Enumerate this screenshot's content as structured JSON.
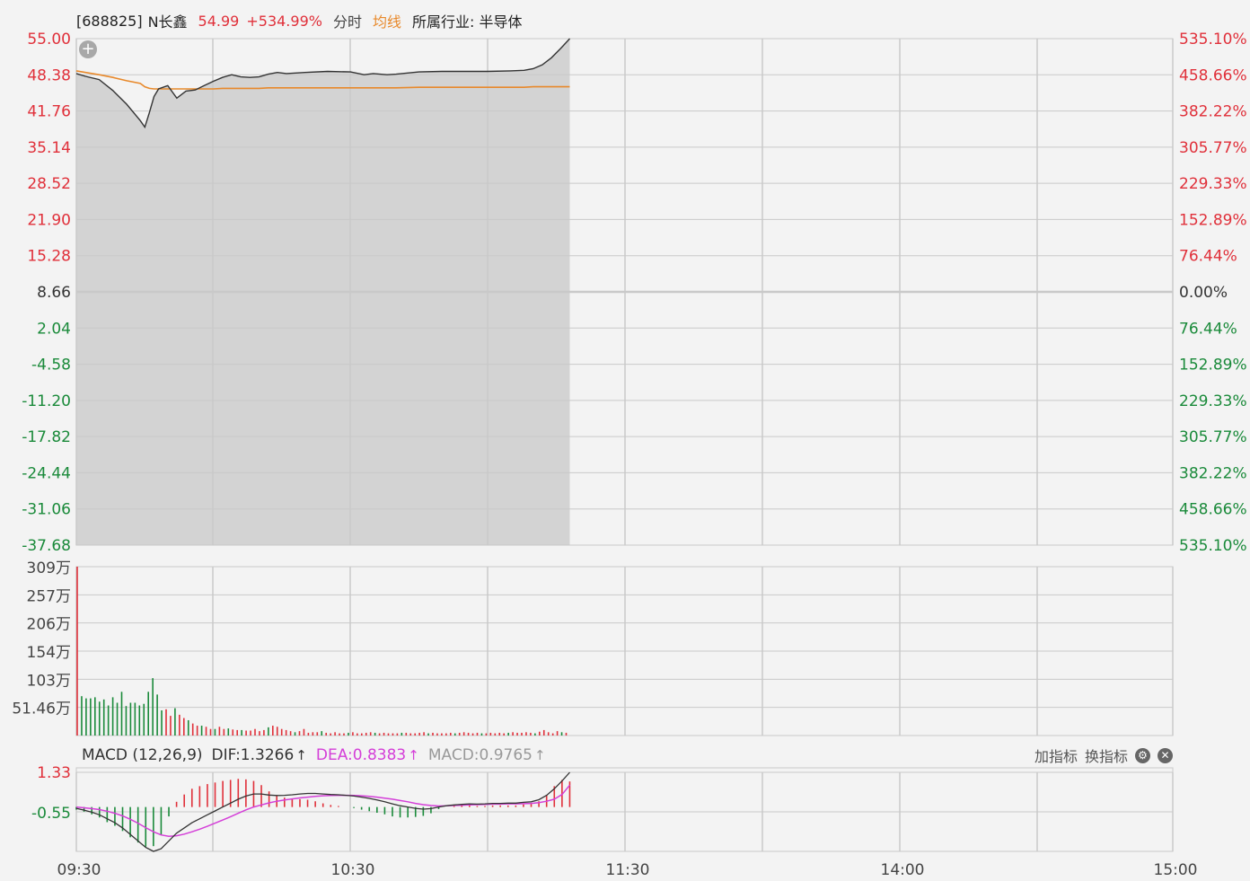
{
  "header": {
    "code": "[688825]",
    "name": "N长鑫",
    "price": "54.99",
    "change_pct": "+534.99%",
    "mode_label": "分时",
    "avg_label": "均线",
    "industry": "所属行业: 半导体"
  },
  "macd_header": {
    "title": "MACD (12,26,9)",
    "dif": "DIF:1.3266",
    "dea": "DEA:0.8383",
    "macd": "MACD:0.9765",
    "up_arrow": "↑"
  },
  "tools": {
    "add_indicator": "加指标",
    "switch_indicator": "换指标",
    "settings_icon": "gear-icon",
    "close_icon": "close-icon",
    "add_icon": "plus-icon"
  },
  "colors": {
    "up": "#e0303a",
    "down": "#1a8a3a",
    "price_line": "#333333",
    "avg_line": "#e8892b",
    "dea_line": "#d43fd8",
    "area_fill": "#c8c8c8",
    "grid": "#c9c9c9"
  },
  "chart_data": [
    {
      "type": "line",
      "panel": "price",
      "x_ticks": [
        "09:30",
        "10:30",
        "11:30",
        "14:00",
        "15:00"
      ],
      "y_left_ticks": [
        "55.00",
        "48.38",
        "41.76",
        "35.14",
        "28.52",
        "21.90",
        "15.28",
        "8.66",
        "2.04",
        "-4.58",
        "-11.20",
        "-17.82",
        "-24.44",
        "-31.06",
        "-37.68"
      ],
      "y_right_ticks": [
        "535.10%",
        "458.66%",
        "382.22%",
        "305.77%",
        "229.33%",
        "152.89%",
        "76.44%",
        "0.00%",
        "76.44%",
        "152.89%",
        "229.33%",
        "305.77%",
        "382.22%",
        "458.66%",
        "535.10%"
      ],
      "ylim": [
        -37.68,
        55.0
      ],
      "preclose": 8.66,
      "x_minutes": [
        0,
        2,
        5,
        8,
        11,
        14,
        15,
        16,
        17,
        18,
        20,
        22,
        24,
        26,
        28,
        30,
        32,
        34,
        36,
        38,
        40,
        42,
        44,
        46,
        48,
        50,
        55,
        60,
        63,
        65,
        68,
        70,
        75,
        80,
        85,
        90,
        95,
        98,
        100,
        102,
        104,
        106,
        108
      ],
      "series": [
        {
          "values": [
            48.6,
            48.1,
            47.5,
            45.5,
            43.0,
            40.0,
            38.8,
            41.5,
            44.4,
            45.8,
            46.4,
            44.1,
            45.4,
            45.6,
            46.4,
            47.2,
            47.9,
            48.4,
            48.0,
            47.9,
            48.0,
            48.5,
            48.8,
            48.6,
            48.7,
            48.8,
            49.0,
            48.9,
            48.4,
            48.6,
            48.4,
            48.5,
            48.9,
            49.0,
            49.0,
            49.0,
            49.1,
            49.2,
            49.5,
            50.2,
            51.5,
            53.2,
            55.0
          ]
        },
        {
          "name": "均线",
          "values": [
            49.1,
            48.8,
            48.4,
            47.9,
            47.3,
            46.8,
            46.2,
            45.9,
            45.8,
            45.8,
            45.8,
            45.8,
            45.8,
            45.8,
            45.8,
            45.8,
            45.9,
            45.9,
            45.9,
            45.9,
            45.9,
            46.0,
            46.0,
            46.0,
            46.0,
            46.0,
            46.0,
            46.0,
            46.0,
            46.0,
            46.0,
            46.0,
            46.1,
            46.1,
            46.1,
            46.1,
            46.1,
            46.1,
            46.2,
            46.2,
            46.2,
            46.2,
            46.2
          ]
        }
      ]
    },
    {
      "type": "bar",
      "panel": "volume",
      "y_ticks": [
        "309万",
        "257万",
        "206万",
        "154万",
        "103万",
        "51.46万"
      ],
      "ylim": [
        0,
        309
      ],
      "series": [
        {
          "values": [
            309,
            72,
            68,
            68,
            70,
            62,
            66,
            55,
            70,
            60,
            80,
            54,
            60,
            60,
            55,
            58,
            80,
            105,
            75,
            46,
            48,
            36,
            50,
            38,
            32,
            28,
            22,
            18,
            18,
            16,
            12,
            12,
            16,
            12,
            13,
            11,
            10,
            10,
            9,
            9,
            12,
            8,
            10,
            15,
            18,
            16,
            12,
            10,
            8,
            6,
            8,
            12,
            5,
            6,
            6,
            8,
            5,
            4,
            6,
            4,
            4,
            5,
            6,
            4,
            4,
            5,
            6,
            5,
            4,
            5,
            4,
            4,
            4,
            5,
            5,
            4,
            4,
            5,
            6,
            4,
            5,
            4,
            4,
            4,
            5,
            4,
            5,
            6,
            5,
            4,
            5,
            4,
            4,
            5,
            4,
            5,
            4,
            5,
            6,
            5,
            5,
            6,
            5,
            4,
            7,
            10,
            6,
            4,
            8,
            6,
            5
          ]
        }
      ]
    },
    {
      "type": "bar",
      "panel": "macd",
      "y_ticks": [
        "1.33",
        "-0.55"
      ],
      "ylim": [
        -1.7,
        1.33
      ],
      "series": [
        {
          "name": "DIF",
          "values": [
            -0.05,
            -0.12,
            -0.2,
            -0.3,
            -0.45,
            -0.6,
            -0.8,
            -1.05,
            -1.3,
            -1.55,
            -1.7,
            -1.6,
            -1.3,
            -1.0,
            -0.8,
            -0.6,
            -0.45,
            -0.3,
            -0.15,
            0.0,
            0.15,
            0.3,
            0.42,
            0.5,
            0.5,
            0.46,
            0.44,
            0.45,
            0.47,
            0.5,
            0.52,
            0.52,
            0.5,
            0.48,
            0.47,
            0.45,
            0.42,
            0.38,
            0.33,
            0.27,
            0.2,
            0.12,
            0.05,
            0.0,
            -0.05,
            -0.08,
            -0.06,
            0.0,
            0.05,
            0.08,
            0.1,
            0.12,
            0.11,
            0.12,
            0.14,
            0.14,
            0.15,
            0.15,
            0.18,
            0.2,
            0.28,
            0.45,
            0.7,
            1.0,
            1.33
          ]
        },
        {
          "name": "DEA",
          "values": [
            0.0,
            -0.03,
            -0.06,
            -0.1,
            -0.16,
            -0.24,
            -0.34,
            -0.47,
            -0.62,
            -0.79,
            -0.95,
            -1.07,
            -1.12,
            -1.1,
            -1.04,
            -0.95,
            -0.85,
            -0.74,
            -0.62,
            -0.5,
            -0.37,
            -0.24,
            -0.11,
            0.0,
            0.08,
            0.16,
            0.22,
            0.27,
            0.31,
            0.35,
            0.38,
            0.41,
            0.43,
            0.44,
            0.45,
            0.45,
            0.44,
            0.43,
            0.41,
            0.38,
            0.34,
            0.3,
            0.25,
            0.2,
            0.14,
            0.09,
            0.06,
            0.04,
            0.05,
            0.06,
            0.07,
            0.08,
            0.09,
            0.1,
            0.11,
            0.11,
            0.12,
            0.12,
            0.13,
            0.14,
            0.17,
            0.22,
            0.3,
            0.48,
            0.84
          ]
        },
        {
          "name": "MACD",
          "values": [
            -0.1,
            -0.18,
            -0.28,
            -0.4,
            -0.58,
            -0.72,
            -0.92,
            -1.16,
            -1.36,
            -1.52,
            -1.5,
            -1.06,
            -0.36,
            0.2,
            0.48,
            0.7,
            0.8,
            0.88,
            0.94,
            1.0,
            1.04,
            1.08,
            1.06,
            1.0,
            0.84,
            0.6,
            0.44,
            0.36,
            0.32,
            0.3,
            0.28,
            0.22,
            0.14,
            0.08,
            0.04,
            0.0,
            -0.04,
            -0.1,
            -0.16,
            -0.22,
            -0.28,
            -0.36,
            -0.4,
            -0.4,
            -0.38,
            -0.34,
            -0.24,
            -0.08,
            0.0,
            0.04,
            0.06,
            0.08,
            0.04,
            0.04,
            0.06,
            0.06,
            0.06,
            0.06,
            0.1,
            0.12,
            0.22,
            0.46,
            0.8,
            1.04,
            0.98
          ]
        }
      ]
    }
  ]
}
